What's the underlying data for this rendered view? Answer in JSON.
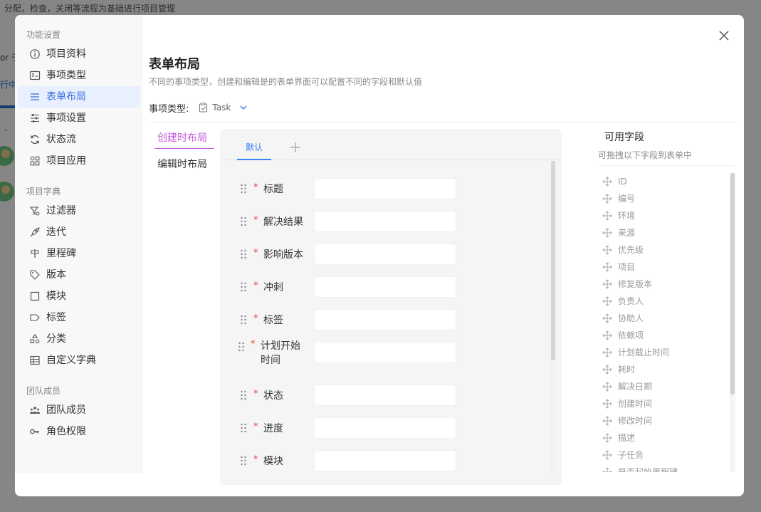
{
  "background": {
    "top_text": "分配，检查，关闭等流程为基础进行项目管理",
    "frag1": "or 于",
    "frag2": "行中"
  },
  "sidebar": {
    "groups": [
      {
        "title": "功能设置",
        "items": [
          {
            "label": "项目资料",
            "icon": "info-icon"
          },
          {
            "label": "事项类型",
            "icon": "issue-type-icon"
          },
          {
            "label": "表单布局",
            "icon": "form-layout-icon",
            "active": true
          },
          {
            "label": "事项设置",
            "icon": "settings-sliders-icon"
          },
          {
            "label": "状态流",
            "icon": "refresh-icon"
          },
          {
            "label": "项目应用",
            "icon": "apps-icon"
          }
        ]
      },
      {
        "title": "项目字典",
        "items": [
          {
            "label": "过滤器",
            "icon": "filter-icon"
          },
          {
            "label": "迭代",
            "icon": "rocket-icon"
          },
          {
            "label": "里程碑",
            "icon": "milestone-icon"
          },
          {
            "label": "版本",
            "icon": "tag-icon"
          },
          {
            "label": "模块",
            "icon": "square-icon"
          },
          {
            "label": "标签",
            "icon": "label-icon"
          },
          {
            "label": "分类",
            "icon": "category-icon"
          },
          {
            "label": "自定义字典",
            "icon": "table-icon"
          }
        ]
      },
      {
        "title": "团队成员",
        "items": [
          {
            "label": "团队成员",
            "icon": "team-icon"
          },
          {
            "label": "角色权限",
            "icon": "key-icon"
          }
        ]
      }
    ]
  },
  "header": {
    "title": "表单布局",
    "subtitle": "不同的事项类型，创建和编辑是的表单界面可以配置不同的字段和默认值",
    "issue_type_label": "事项类型:",
    "issue_type_value": "Task"
  },
  "layout_tabs": {
    "create": "创建时布局",
    "edit": "编辑时布局"
  },
  "form": {
    "tab_default": "默认",
    "fields": [
      {
        "label": "标题",
        "required": true
      },
      {
        "label": "解决结果",
        "required": true
      },
      {
        "label": "影响版本",
        "required": true
      },
      {
        "label": "冲刺",
        "required": true
      },
      {
        "label": "标签",
        "required": true
      },
      {
        "label": "计划开始时间",
        "required": true
      },
      {
        "label": "状态",
        "required": true
      },
      {
        "label": "进度",
        "required": true
      },
      {
        "label": "模块",
        "required": true
      }
    ]
  },
  "available": {
    "title": "可用字段",
    "subtitle": "可拖拽以下字段到表单中",
    "items": [
      "ID",
      "编号",
      "环境",
      "来源",
      "优先级",
      "项目",
      "修复版本",
      "负责人",
      "协助人",
      "依赖项",
      "计划截止时间",
      "耗时",
      "解决日期",
      "创建时间",
      "修改时间",
      "描述",
      "子任务",
      "是否起始里程碑"
    ]
  },
  "colors": {
    "active_nav": "#3b6fe0",
    "active_layout_tab": "#c25bd9",
    "required_star": "#e2483d",
    "form_tab_active": "#3b82f6"
  }
}
